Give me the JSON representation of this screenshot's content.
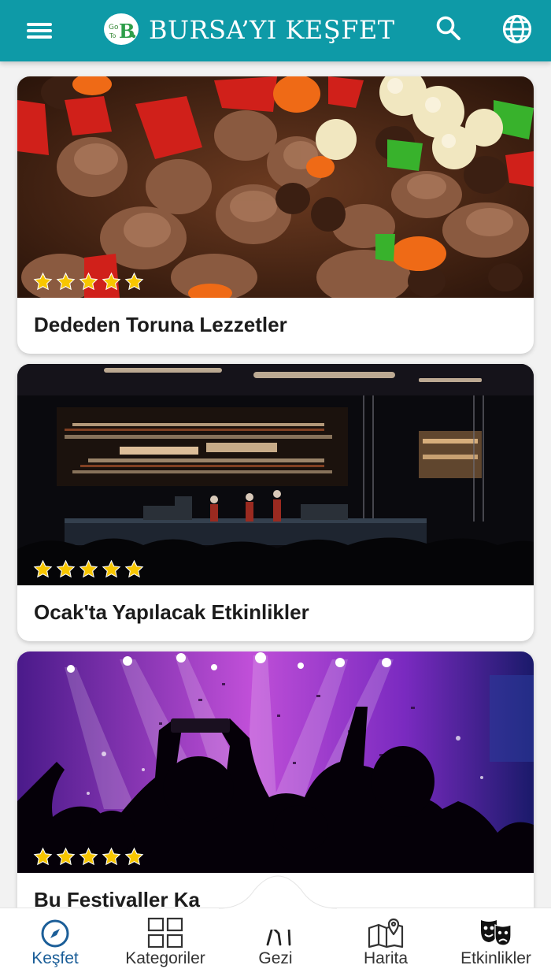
{
  "header": {
    "brand": "BURSA’YI KEŞFET",
    "logo_text": "GoToB",
    "colors": {
      "bar": "#0e9aa7",
      "text": "#ffffff"
    }
  },
  "cards": [
    {
      "title": "Dededen Toruna Lezzetler",
      "rating": 5,
      "image": "food-stew-image"
    },
    {
      "title": "Ocak'ta Yapılacak Etkinlikler",
      "rating": 5,
      "image": "concert-stage-image"
    },
    {
      "title": "Bu Festivaller Ka",
      "rating": 5,
      "image": "festival-crowd-image"
    }
  ],
  "bottom_nav": {
    "items": [
      {
        "label": "Keşfet",
        "icon": "compass-icon",
        "active": true
      },
      {
        "label": "Kategoriler",
        "icon": "grid-icon",
        "active": false
      },
      {
        "label": "Gezi",
        "icon": "hiker-icon",
        "active": false
      },
      {
        "label": "Harita",
        "icon": "map-pin-icon",
        "active": false
      },
      {
        "label": "Etkinlikler",
        "icon": "theater-masks-icon",
        "active": false
      }
    ],
    "colors": {
      "active": "#1b5e98",
      "inactive": "#333333",
      "star": "#f7c600"
    }
  }
}
